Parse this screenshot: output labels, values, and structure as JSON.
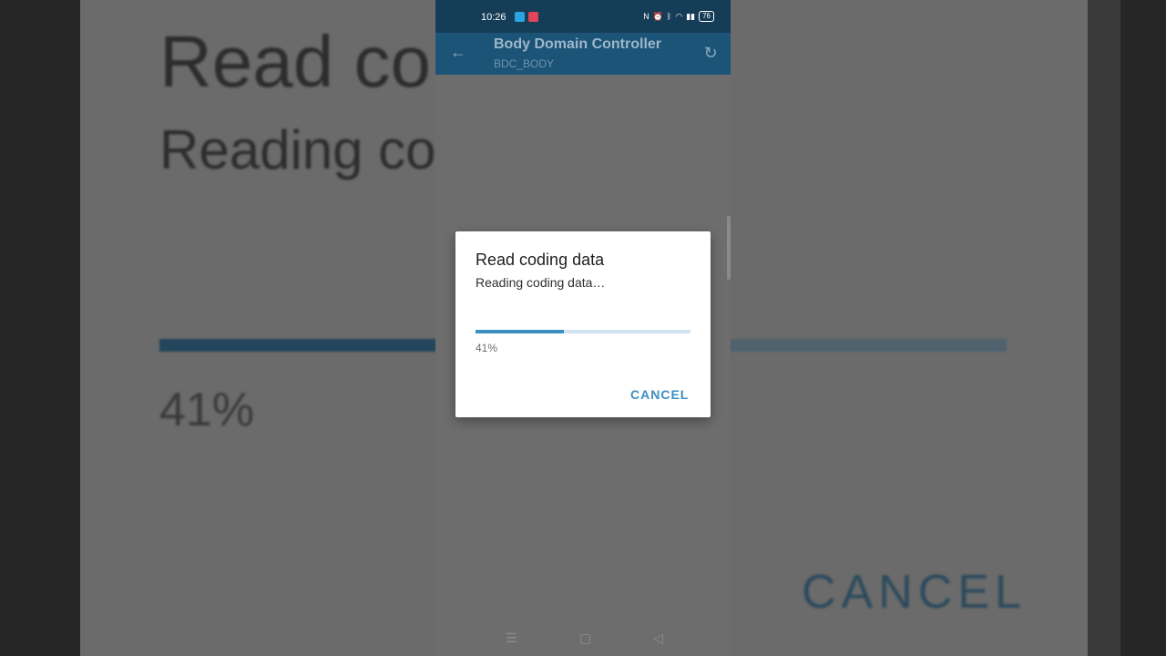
{
  "background_zoom": {
    "title_fragment": "Read co",
    "subtitle_fragment": "Reading co",
    "percent": "41%",
    "cancel": "CANCEL"
  },
  "status_bar": {
    "time": "10:26",
    "battery": "76"
  },
  "app_bar": {
    "title": "Body Domain Controller",
    "subtitle": "BDC_BODY"
  },
  "dialog": {
    "title": "Read coding data",
    "message": "Reading coding data…",
    "progress_percent": 41,
    "progress_label": "41%",
    "cancel_label": "CANCEL"
  },
  "colors": {
    "app_bar": "#1c5478",
    "status_bar": "#163d57",
    "accent": "#3d8fc2",
    "progress_track": "#cfe4ef"
  },
  "icons": {
    "back": "arrow-left-icon",
    "refresh": "refresh-icon",
    "nav_menu": "menu-icon",
    "nav_home": "home-icon",
    "nav_back": "triangle-back-icon"
  }
}
